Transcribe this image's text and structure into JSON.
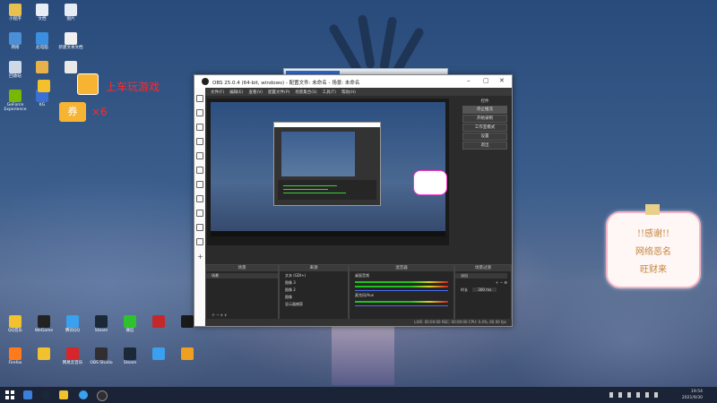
{
  "desktop": {
    "icons_left_top": [
      {
        "label": "小程序",
        "color": "#e8c050"
      },
      {
        "label": "网络",
        "color": "#4a8fd8"
      },
      {
        "label": "回收站",
        "color": "#cfd8e6"
      },
      {
        "label": "GeForce Experience",
        "color": "#76b900"
      }
    ],
    "icons_col2": [
      {
        "label": "文档",
        "color": "#e9eef6"
      },
      {
        "label": "此电脑",
        "color": "#3a8fe0"
      },
      {
        "label": "",
        "color": "#e8b24a"
      },
      {
        "label": "KG",
        "color": "#3a6fd3"
      }
    ],
    "icons_col3": [
      {
        "label": "图片",
        "color": "#e6ecf5"
      },
      {
        "label": "新建文本文档",
        "color": "#f0f0f0"
      },
      {
        "label": "",
        "color": "#e9e9e9"
      }
    ],
    "icons_bottom_row1": [
      {
        "label": "QQ音乐",
        "color": "#f2c12e"
      },
      {
        "label": "WeGame",
        "color": "#222"
      },
      {
        "label": "腾讯QQ",
        "color": "#3aa0f0"
      },
      {
        "label": "Steam",
        "color": "#1b2838"
      },
      {
        "label": "微信",
        "color": "#2ec32e"
      },
      {
        "label": "",
        "color": "#c52828"
      },
      {
        "label": "",
        "color": "#1a1a1a"
      }
    ],
    "icons_bottom_row2": [
      {
        "label": "Firefox",
        "color": "#ff7a1a"
      },
      {
        "label": "",
        "color": "#f2c12e"
      },
      {
        "label": "网易云音乐",
        "color": "#d6262a"
      },
      {
        "label": "OBS Studio",
        "color": "#302e31"
      },
      {
        "label": "Steam",
        "color": "#1b2838"
      },
      {
        "label": "",
        "color": "#3aa0f0"
      },
      {
        "label": "",
        "color": "#f0a020"
      }
    ]
  },
  "promo": {
    "text1": "上车玩游戏",
    "coupon": "券",
    "times": "×6"
  },
  "obs": {
    "title": "OBS 25.0.4 (64-bit, windows) - 配置文件: 未命名 - 场景: 未命名",
    "menus": [
      "文件(F)",
      "编辑(E)",
      "查看(V)",
      "配置文件(P)",
      "场景集合(S)",
      "工具(T)",
      "帮助(H)"
    ],
    "controls_header": "控件",
    "buttons": [
      "停止推流",
      "开始录制",
      "工作室模式",
      "设置",
      "退出"
    ],
    "panels": {
      "scenes": "场景",
      "scene_item": "场景",
      "sources": "来源",
      "sources_items": [
        "文本 (GDI+)",
        "图像 3",
        "图像 2",
        "图像",
        "显示器捕获"
      ],
      "mixer": "混音器",
      "mixer_items": [
        "桌面音频",
        "麦克风/Aux"
      ],
      "transitions": "场景过渡",
      "fade": "淡出",
      "duration_label": "时长",
      "duration_value": "300 ms"
    },
    "status": "LIVE: 00:00:00   REC: 00:00:00   CPU: 0.4%, 60.00 fps"
  },
  "sign": {
    "line1": "!!感谢!!",
    "line2": "网络恶名",
    "line3": "旺财来"
  },
  "taskbar": {
    "time": "19:54",
    "date": "2021/9/30"
  }
}
